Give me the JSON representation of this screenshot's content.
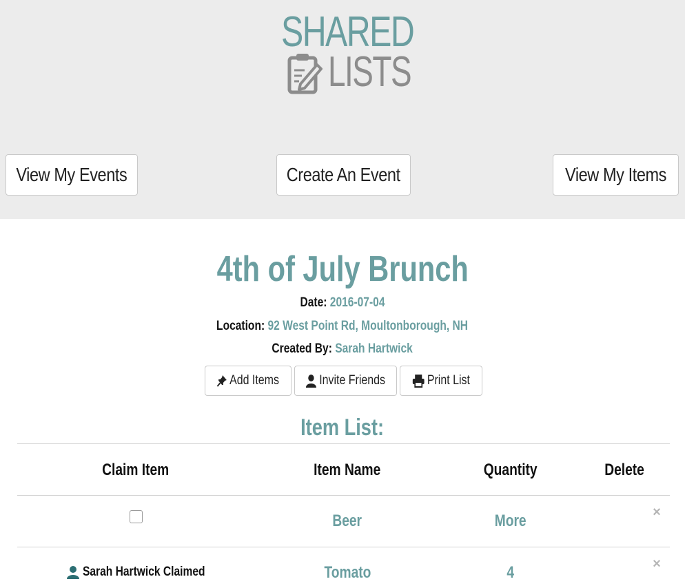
{
  "logo": {
    "line1": "SHARED",
    "line2": "LISTS"
  },
  "nav": {
    "view_events": "View My Events",
    "create_event": "Create An Event",
    "view_items": "View My Items"
  },
  "event": {
    "title": "4th of July Brunch",
    "date_label": "Date:",
    "date": "2016-07-04",
    "location_label": "Location:",
    "location": "92 West Point Rd, Moultonborough, NH",
    "created_by_label": "Created By:",
    "created_by": "Sarah Hartwick"
  },
  "actions": {
    "add_items": "Add Items",
    "invite_friends": "Invite Friends",
    "print_list": "Print List"
  },
  "item_list": {
    "title": "Item List:",
    "columns": [
      "Claim Item",
      "Item Name",
      "Quantity",
      "Delete"
    ],
    "rows": [
      {
        "claimed": false,
        "claim_text": "",
        "name": "Beer",
        "quantity": "More",
        "delete_icon": "×"
      },
      {
        "claimed": true,
        "claim_text": "Sarah Hartwick Claimed",
        "name": "Tomato",
        "quantity": "4",
        "delete_icon": "×"
      }
    ]
  },
  "colors": {
    "accent": "#6a9ea0",
    "logo_gray": "#8c8c8c",
    "header_bg": "#ececec"
  },
  "icons": [
    "clipboard-pencil-icon",
    "pushpin-icon",
    "user-icon",
    "printer-icon",
    "close-icon"
  ]
}
